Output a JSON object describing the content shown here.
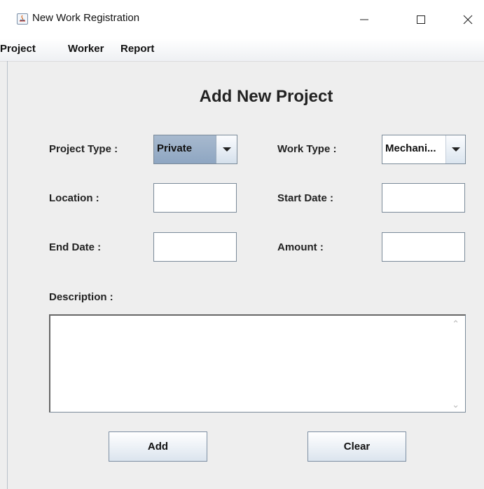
{
  "window": {
    "title": "New Work Registration"
  },
  "menu": {
    "items": [
      "Project",
      "Worker",
      "Report"
    ]
  },
  "form": {
    "heading": "Add New Project",
    "project_type": {
      "label": "Project Type :",
      "value": "Private"
    },
    "work_type": {
      "label": "Work Type :",
      "value": "Mechani..."
    },
    "location": {
      "label": "Location :",
      "value": ""
    },
    "start_date": {
      "label": "Start Date :",
      "value": ""
    },
    "end_date": {
      "label": "End Date :",
      "value": ""
    },
    "amount": {
      "label": "Amount :",
      "value": ""
    },
    "description": {
      "label": "Description :",
      "value": ""
    }
  },
  "buttons": {
    "add": "Add",
    "clear": "Clear"
  },
  "icons": {
    "app": "java-app-icon",
    "minimize": "minimize-icon",
    "maximize": "maximize-icon",
    "close": "close-icon",
    "dropdown": "chevron-down-icon",
    "scroll_up": "scroll-up-icon",
    "scroll_down": "scroll-down-icon"
  },
  "colors": {
    "window_bg": "#eeeeee",
    "selected_combo_bg": "#9fb3ca",
    "button_gradient_bottom": "#dbe4ee"
  }
}
